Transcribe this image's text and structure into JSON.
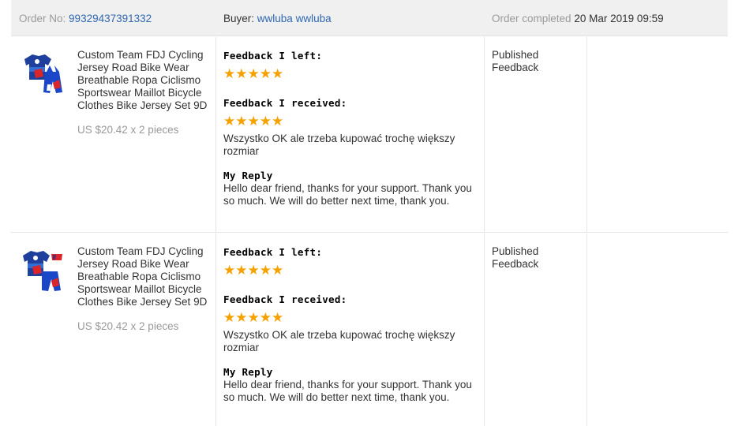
{
  "header": {
    "order_label": "Order No:",
    "order_number": "99329437391332",
    "buyer_label": "Buyer:",
    "buyer_name": "wwluba wwluba",
    "completed_label": "Order completed",
    "completed_date": "20 Mar 2019 09:59"
  },
  "colors": {
    "star": "#f5a100",
    "link": "#2f67b1",
    "header_bg": "#f0f0f0"
  },
  "items": [
    {
      "product_title": "Custom Team FDJ Cycling Jersey Road Bike Wear Breathable Ropa Ciclismo Sportswear Maillot Bicycle Clothes Bike Jersey Set 9D",
      "price": "US $20.42 x 2 pieces",
      "feedback_left_heading": "Feedback I left:",
      "feedback_left_stars": "★★★★★",
      "feedback_left_rating": 5,
      "feedback_received_heading": "Feedback I received:",
      "feedback_received_stars": "★★★★★",
      "feedback_received_rating": 5,
      "feedback_received_text": "Wszystko OK ale trzeba kupować trochę większy rozmiar",
      "reply_heading": "My Reply",
      "reply_text": "Hello dear friend, thanks for your support. Thank you so much. We will do better next time, thank you.",
      "status": "Published Feedback"
    },
    {
      "product_title": "Custom Team FDJ Cycling Jersey Road Bike Wear Breathable Ropa Ciclismo Sportswear Maillot Bicycle Clothes Bike Jersey Set 9D",
      "price": "US $20.42 x 2 pieces",
      "feedback_left_heading": "Feedback I left:",
      "feedback_left_stars": "★★★★★",
      "feedback_left_rating": 5,
      "feedback_received_heading": "Feedback I received:",
      "feedback_received_stars": "★★★★★",
      "feedback_received_rating": 5,
      "feedback_received_text": "Wszystko OK ale trzeba kupować trochę większy rozmiar",
      "reply_heading": "My Reply",
      "reply_text": "Hello dear friend, thanks for your support. Thank you so much. We will do better next time, thank you.",
      "status": "Published Feedback"
    }
  ]
}
